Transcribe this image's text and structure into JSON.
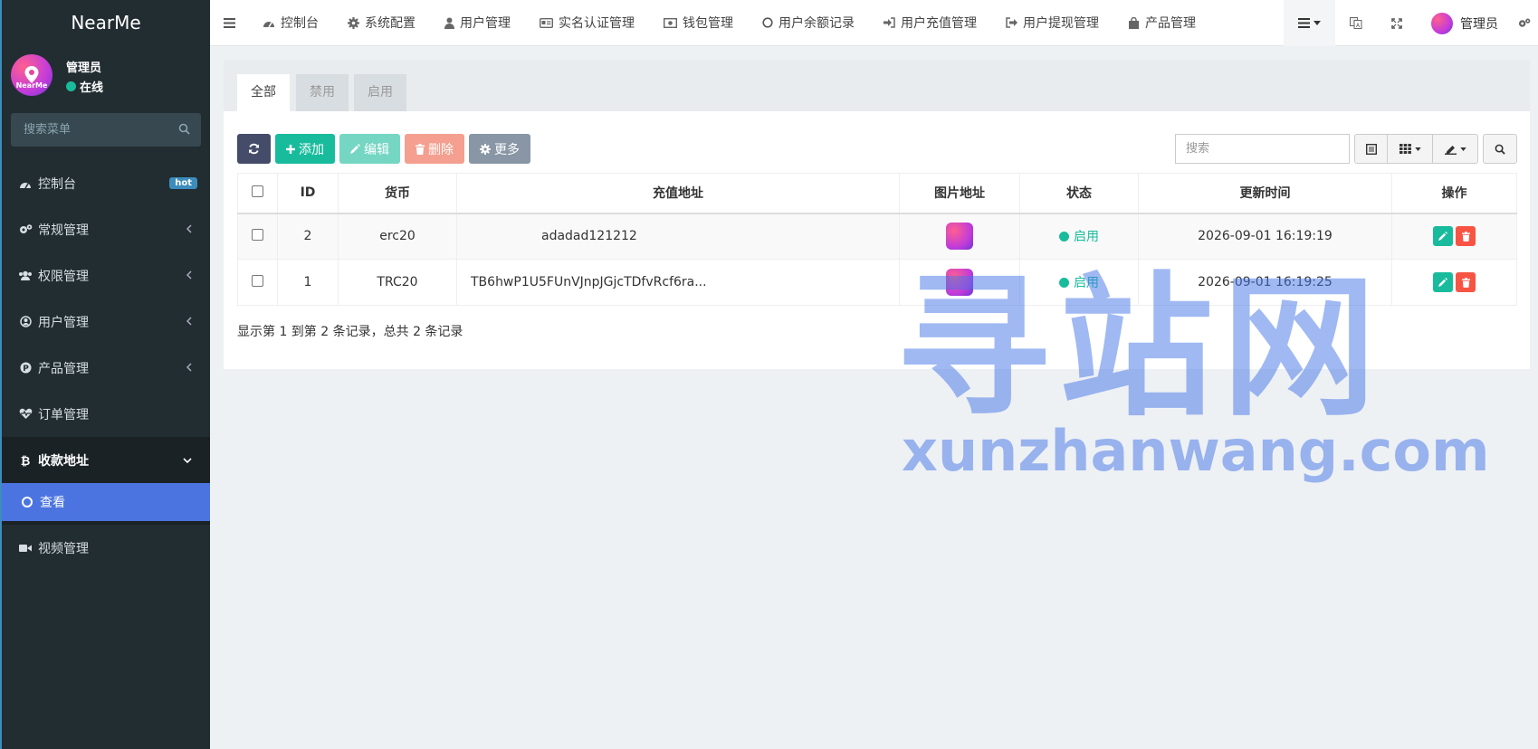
{
  "brand": "NearMe",
  "user": {
    "name": "管理员",
    "status": "在线",
    "avatar_label": "NearMe"
  },
  "sidebar_search": {
    "placeholder": "搜索菜单"
  },
  "menu": [
    {
      "label": "控制台",
      "icon": "dashboard-icon",
      "badge": "hot"
    },
    {
      "label": "常规管理",
      "icon": "cogs-icon"
    },
    {
      "label": "权限管理",
      "icon": "group-icon"
    },
    {
      "label": "用户管理",
      "icon": "user-circle-icon"
    },
    {
      "label": "产品管理",
      "icon": "product-icon"
    },
    {
      "label": "订单管理",
      "icon": "heartbeat-icon"
    },
    {
      "label": "收款地址",
      "icon": "bitcoin-icon",
      "expanded": true
    },
    {
      "label": "视频管理",
      "icon": "video-icon"
    }
  ],
  "submenu_active": "查看",
  "topnav": [
    {
      "label": "控制台",
      "icon": "dashboard-icon"
    },
    {
      "label": "系统配置",
      "icon": "cog-icon"
    },
    {
      "label": "用户管理",
      "icon": "user-icon"
    },
    {
      "label": "实名认证管理",
      "icon": "id-card-icon"
    },
    {
      "label": "钱包管理",
      "icon": "money-icon"
    },
    {
      "label": "用户余额记录",
      "icon": "circle-icon"
    },
    {
      "label": "用户充值管理",
      "icon": "sign-in-icon"
    },
    {
      "label": "用户提现管理",
      "icon": "sign-out-icon"
    },
    {
      "label": "产品管理",
      "icon": "shopping-bag-icon"
    }
  ],
  "topnav_user": "管理员",
  "tabs": [
    "全部",
    "禁用",
    "启用"
  ],
  "toolbar": {
    "add": "添加",
    "edit": "编辑",
    "delete": "删除",
    "more": "更多"
  },
  "table_search": {
    "placeholder": "搜索"
  },
  "columns": [
    "ID",
    "货币",
    "充值地址",
    "图片地址",
    "状态",
    "更新时间",
    "操作"
  ],
  "rows": [
    {
      "id": "2",
      "currency": "erc20",
      "address": "adadad121212",
      "status": "启用",
      "updated": "2026-09-01 16:19:19"
    },
    {
      "id": "1",
      "currency": "TRC20",
      "address": "TB6hwP1U5FUnVJnpJGjcTDfvRcf6ra...",
      "status": "启用",
      "updated": "2026-09-01 16:19:25"
    }
  ],
  "summary": "显示第 1 到第 2 条记录，总共 2 条记录",
  "watermark": {
    "cn": "寻站网",
    "en": "xunzhanwang.com"
  },
  "colors": {
    "sidebar": "#222d32",
    "active_menu": "#4c74e0",
    "green": "#18bc9c",
    "red": "#f75444"
  }
}
